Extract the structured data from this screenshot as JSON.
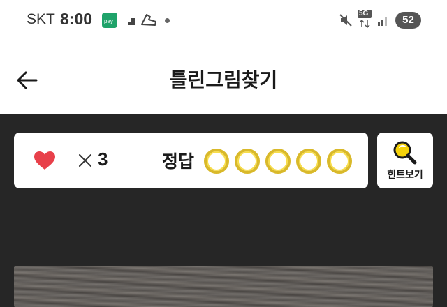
{
  "status_bar": {
    "carrier": "SKT",
    "time": "8:00",
    "pay_icon_label": "pay",
    "network_label": "5G",
    "battery": "52"
  },
  "header": {
    "title": "틀린그림찾기"
  },
  "game": {
    "lives_count": "3",
    "answer_label": "정답",
    "answers_found": 0,
    "answers_total": 5,
    "hint_label": "힌트보기"
  },
  "colors": {
    "heart": "#e8404a",
    "answer_ring": "#d9b92a",
    "hint_icon": "#f5d20a",
    "game_background": "#262626"
  }
}
